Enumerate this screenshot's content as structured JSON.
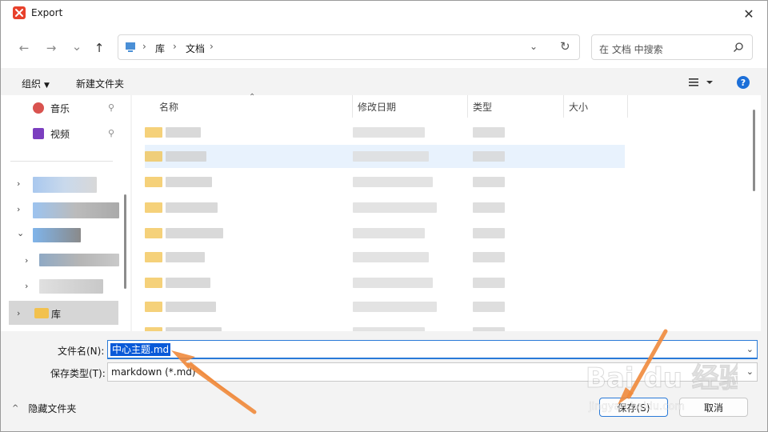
{
  "window": {
    "title": "Export",
    "close_glyph": "✕"
  },
  "nav": {
    "back_glyph": "←",
    "forward_glyph": "→",
    "recent_glyph": "⌄",
    "up_glyph": "↑",
    "breadcrumb": [
      "库",
      "文档"
    ],
    "separator": "›",
    "dropdown_glyph": "⌄",
    "refresh_glyph": "↻",
    "search_placeholder": "在 文档 中搜索"
  },
  "toolbar": {
    "organize_label": "组织",
    "organize_caret": "▼",
    "new_folder_label": "新建文件夹",
    "help_label": "?"
  },
  "nav_pane": {
    "quick_items": [
      {
        "label": "音乐",
        "icon": "music-icon",
        "color": "#d9534f"
      },
      {
        "label": "视频",
        "icon": "video-icon",
        "color": "#7b3fbf"
      }
    ],
    "pin_glyph": "📌",
    "chevron_right": "›",
    "chevron_down": "⌄",
    "library_label": "库"
  },
  "file_list": {
    "columns": [
      "名称",
      "修改日期",
      "类型",
      "大小"
    ],
    "sort_glyph": "⌃"
  },
  "footer": {
    "filename_label": "文件名(N):",
    "filename_value": "中心主题.md",
    "filetype_label": "保存类型(T):",
    "filetype_value": "markdown (*.md)",
    "dropdown_glyph": "⌄",
    "hide_folders_label": "隐藏文件夹",
    "hide_chevron": "^",
    "save_label": "保存(S)",
    "cancel_label": "取消"
  },
  "watermark": {
    "text": "Bai du 经验",
    "url": "jingyan.baidu.com"
  },
  "colors": {
    "accent": "#2a7ad8",
    "selection": "#0a5ad8",
    "folder": "#f2c14e",
    "arrow": "#f08a3c"
  }
}
